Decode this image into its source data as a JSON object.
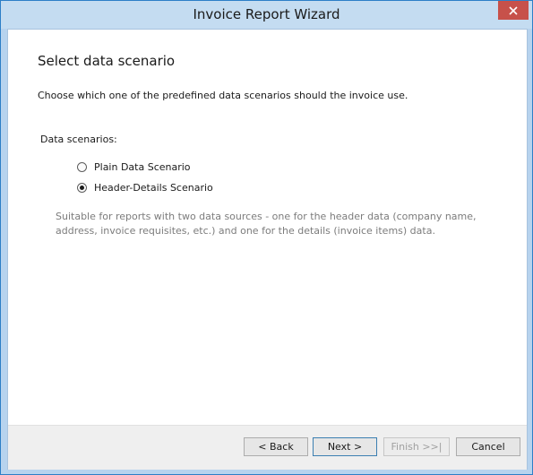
{
  "window": {
    "title": "Invoice Report Wizard",
    "close_icon": "close-icon"
  },
  "page": {
    "title": "Select data scenario",
    "description": "Choose which one of the predefined data scenarios should the invoice use."
  },
  "scenarios": {
    "group_label": "Data scenarios:",
    "options": [
      {
        "label": "Plain Data Scenario",
        "selected": false
      },
      {
        "label": "Header-Details Scenario",
        "selected": true
      }
    ],
    "hint": "Suitable for reports with two data sources - one for the header data (company name, address, invoice requisites, etc.) and one for the details (invoice items) data."
  },
  "footer": {
    "back_label": "< Back",
    "next_label": "Next >",
    "finish_label": "Finish >>|",
    "cancel_label": "Cancel",
    "finish_enabled": false
  }
}
